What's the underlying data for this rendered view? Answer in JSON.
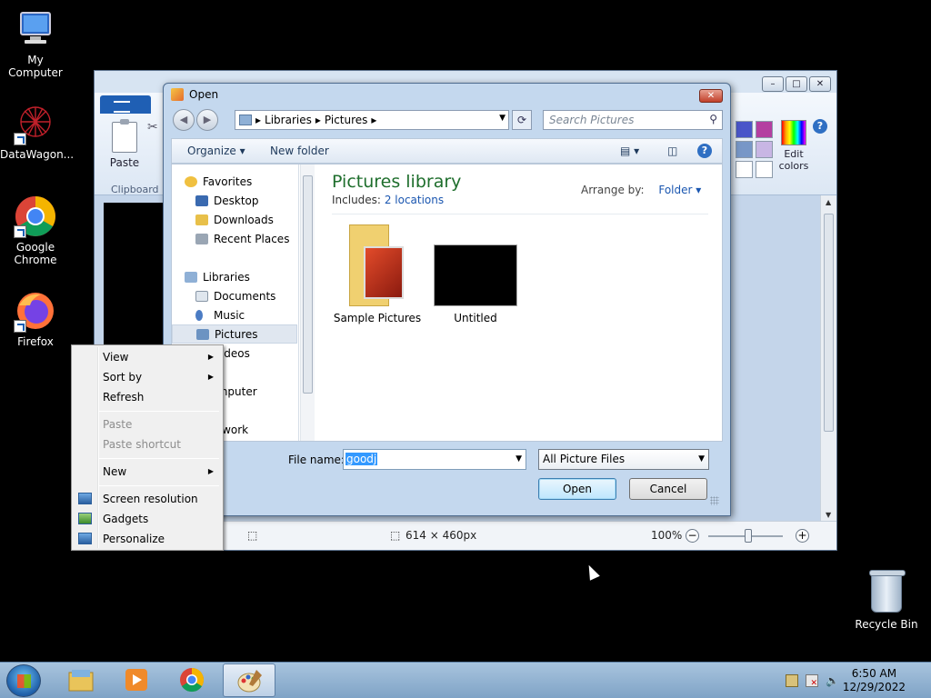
{
  "desktop": {
    "icons": [
      {
        "label": "My Computer",
        "icon": "computer-icon"
      },
      {
        "label": "DataWagon...",
        "icon": "datawagon-icon"
      },
      {
        "label": "Google Chrome",
        "icon": "chrome-icon"
      },
      {
        "label": "Firefox",
        "icon": "firefox-icon"
      }
    ],
    "recycle_bin": "Recycle Bin"
  },
  "paint": {
    "ribbon": {
      "paste": "Paste",
      "clipboard": "Clipboard",
      "edit_colors": "Edit colors"
    },
    "status": {
      "dimensions": "614 × 460px",
      "zoom": "100%"
    },
    "swatches": [
      "#4a56c9",
      "#b43fa1",
      "#7897c7",
      "#c8b6e4",
      "#ffffff",
      "#ffffff"
    ]
  },
  "dialog": {
    "title": "Open",
    "breadcrumb": [
      "Libraries",
      "Pictures"
    ],
    "search_placeholder": "Search Pictures",
    "toolbar": {
      "organize": "Organize",
      "new_folder": "New folder"
    },
    "nav": [
      {
        "label": "Favorites",
        "group": true
      },
      {
        "label": "Desktop"
      },
      {
        "label": "Downloads"
      },
      {
        "label": "Recent Places"
      },
      {
        "label": "Libraries",
        "group": true
      },
      {
        "label": "Documents"
      },
      {
        "label": "Music"
      },
      {
        "label": "Pictures",
        "selected": true
      },
      {
        "label": "Videos"
      },
      {
        "label": "Computer",
        "group": true
      },
      {
        "label": "Network",
        "group": true
      }
    ],
    "library_title": "Pictures library",
    "includes_label": "Includes:",
    "includes_link": "2 locations",
    "arrange_label": "Arrange by:",
    "arrange_value": "Folder",
    "items": [
      {
        "name": "Sample Pictures",
        "kind": "folder"
      },
      {
        "name": "Untitled",
        "kind": "image"
      }
    ],
    "file_name_label": "File name:",
    "file_name_value": "goodj",
    "file_type": "All Picture Files",
    "open_button": "Open",
    "cancel_button": "Cancel"
  },
  "context_menu": {
    "items": [
      {
        "label": "View",
        "submenu": true
      },
      {
        "label": "Sort by",
        "submenu": true
      },
      {
        "label": "Refresh"
      },
      {
        "label": "Paste",
        "disabled": true
      },
      {
        "label": "Paste shortcut",
        "disabled": true
      },
      {
        "label": "New",
        "submenu": true
      },
      {
        "label": "Screen resolution",
        "icon": "monitor-icon"
      },
      {
        "label": "Gadgets",
        "icon": "gadgets-icon"
      },
      {
        "label": "Personalize",
        "icon": "personalize-icon"
      }
    ]
  },
  "taskbar": {
    "apps": [
      "explorer-icon",
      "media-player-icon",
      "chrome-icon",
      "paint-icon"
    ],
    "active_app": "paint-icon",
    "time": "6:50 AM",
    "date": "12/29/2022"
  }
}
